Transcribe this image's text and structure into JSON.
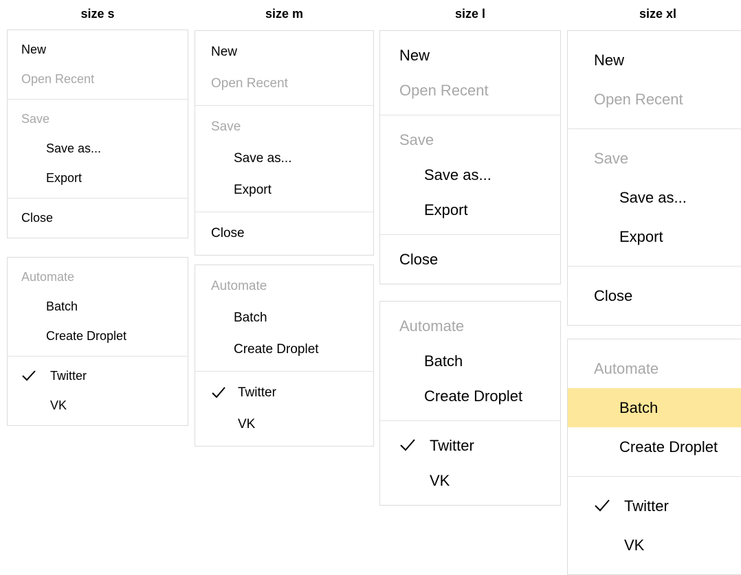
{
  "columns": [
    {
      "title": "size s",
      "menu1": {
        "groups": [
          [
            {
              "label": "New"
            },
            {
              "label": "Open Recent"
            }
          ],
          [
            {
              "label": "Save"
            },
            {
              "label": "Save as..."
            },
            {
              "label": "Export"
            }
          ],
          [
            {
              "label": "Close"
            }
          ]
        ]
      },
      "menu2": {
        "groups": [
          [
            {
              "label": "Automate"
            },
            {
              "label": "Batch"
            },
            {
              "label": "Create Droplet"
            }
          ],
          [
            {
              "label": "Twitter"
            },
            {
              "label": "VK"
            }
          ]
        ]
      }
    },
    {
      "title": "size m",
      "menu1": {
        "groups": [
          [
            {
              "label": "New"
            },
            {
              "label": "Open Recent"
            }
          ],
          [
            {
              "label": "Save"
            },
            {
              "label": "Save as..."
            },
            {
              "label": "Export"
            }
          ],
          [
            {
              "label": "Close"
            }
          ]
        ]
      },
      "menu2": {
        "groups": [
          [
            {
              "label": "Automate"
            },
            {
              "label": "Batch"
            },
            {
              "label": "Create Droplet"
            }
          ],
          [
            {
              "label": "Twitter"
            },
            {
              "label": "VK"
            }
          ]
        ]
      }
    },
    {
      "title": "size l",
      "menu1": {
        "groups": [
          [
            {
              "label": "New"
            },
            {
              "label": "Open Recent"
            }
          ],
          [
            {
              "label": "Save"
            },
            {
              "label": "Save as..."
            },
            {
              "label": "Export"
            }
          ],
          [
            {
              "label": "Close"
            }
          ]
        ]
      },
      "menu2": {
        "groups": [
          [
            {
              "label": "Automate"
            },
            {
              "label": "Batch"
            },
            {
              "label": "Create Droplet"
            }
          ],
          [
            {
              "label": "Twitter"
            },
            {
              "label": "VK"
            }
          ]
        ]
      }
    },
    {
      "title": "size xl",
      "menu1": {
        "groups": [
          [
            {
              "label": "New"
            },
            {
              "label": "Open Recent"
            }
          ],
          [
            {
              "label": "Save"
            },
            {
              "label": "Save as..."
            },
            {
              "label": "Export"
            }
          ],
          [
            {
              "label": "Close"
            }
          ]
        ]
      },
      "menu2": {
        "groups": [
          [
            {
              "label": "Automate"
            },
            {
              "label": "Batch"
            },
            {
              "label": "Create Droplet"
            }
          ],
          [
            {
              "label": "Twitter"
            },
            {
              "label": "VK"
            }
          ]
        ]
      }
    }
  ],
  "states": {
    "disabled_items": [
      "Open Recent",
      "Save",
      "Automate"
    ],
    "checked_item": "Twitter",
    "highlighted_item": "size xl / Batch"
  },
  "icons": {
    "check": "checkmark-icon"
  },
  "colors": {
    "disabled_text": "#a8a8a8",
    "highlight_background": "#fde79a",
    "separator": "#e2e2e2",
    "border": "#dcdcdc"
  }
}
